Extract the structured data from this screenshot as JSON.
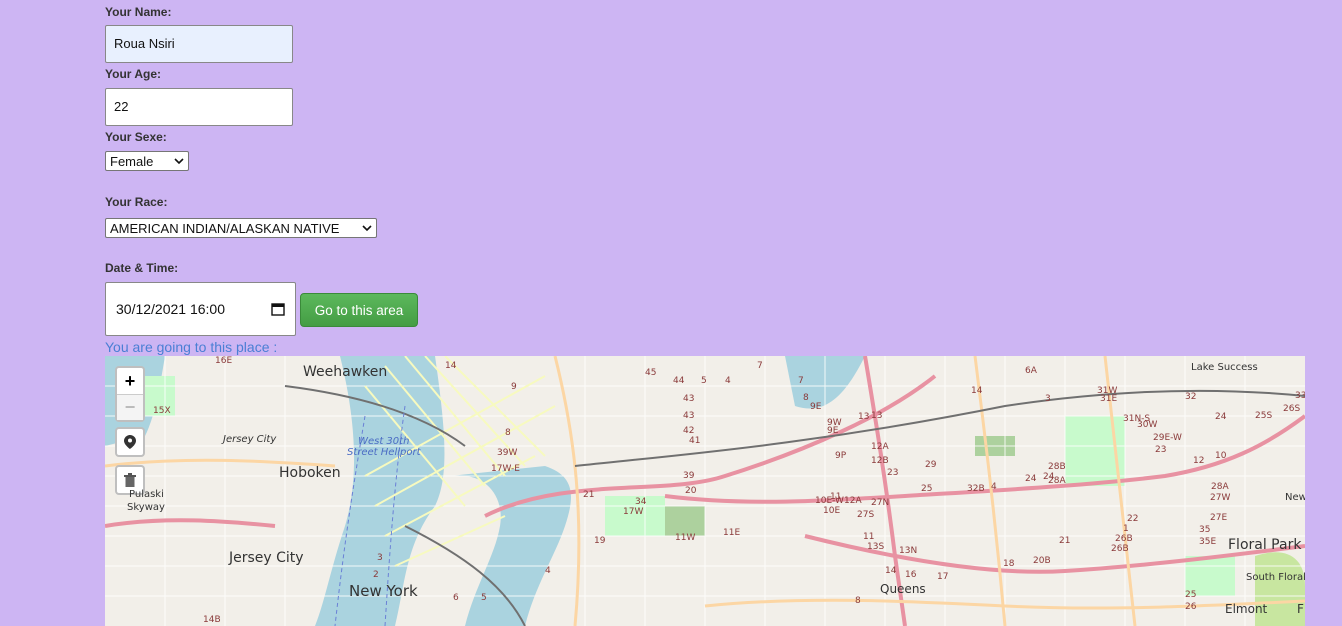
{
  "form": {
    "name_label": "Your Name:",
    "name_value": "Roua Nsiri",
    "age_label": "Your Age:",
    "age_value": "22",
    "sexe_label": "Your Sexe:",
    "sexe_value": "Female",
    "race_label": "Your Race:",
    "race_value": "AMERICAN INDIAN/ALASKAN NATIVE",
    "datetime_label": "Date & Time:",
    "datetime_value": "30/12/2021 16:00",
    "go_button": "Go to this area",
    "going_text": "You are going to this place :"
  },
  "map": {
    "zoom_in": "+",
    "zoom_out": "−",
    "controls": [
      "zoom-in",
      "zoom-out",
      "marker-icon",
      "trash-icon"
    ],
    "places": {
      "weehawken": "Weehawken",
      "hoboken": "Hoboken",
      "jersey_city_small": "Jersey City",
      "jersey_city": "Jersey City",
      "new_york": "New York",
      "queens": "Queens",
      "floral_park": "Floral Park",
      "south_floral_park": "South Floral Park",
      "elmont": "Elmont",
      "lake_success": "Lake Success",
      "pulaski": "Pulaski",
      "skyway": "Skyway",
      "heliport_1": "West 30th",
      "heliport_2": "Street Heliport",
      "new": "New",
      "f": "F"
    },
    "roads": [
      "16E",
      "15X",
      "14",
      "45",
      "44",
      "5",
      "4",
      "7",
      "7",
      "8",
      "9E",
      "14",
      "6A",
      "3",
      "31W",
      "31E",
      "31N-S",
      "32",
      "24",
      "25S",
      "26S",
      "33",
      "13",
      "43",
      "43",
      "42",
      "41",
      "9W",
      "9E",
      "13",
      "12A",
      "12B",
      "23",
      "29",
      "30W",
      "29E-W",
      "23",
      "12",
      "10",
      "9",
      "8",
      "39W",
      "17W-E",
      "39",
      "21",
      "20",
      "10E-W",
      "11",
      "12A",
      "27S",
      "27N",
      "28B",
      "28A",
      "28A",
      "27W",
      "27E",
      "35",
      "35E",
      "34",
      "17W",
      "19",
      "11W",
      "11E",
      "11",
      "13S",
      "13N",
      "14",
      "16",
      "17",
      "18",
      "20B",
      "21",
      "22",
      "1",
      "26B",
      "26B",
      "25",
      "26",
      "24",
      "24",
      "25",
      "32B",
      "4",
      "4",
      "3",
      "2",
      "6",
      "5",
      "8",
      "14B",
      "10E",
      "9P"
    ]
  }
}
